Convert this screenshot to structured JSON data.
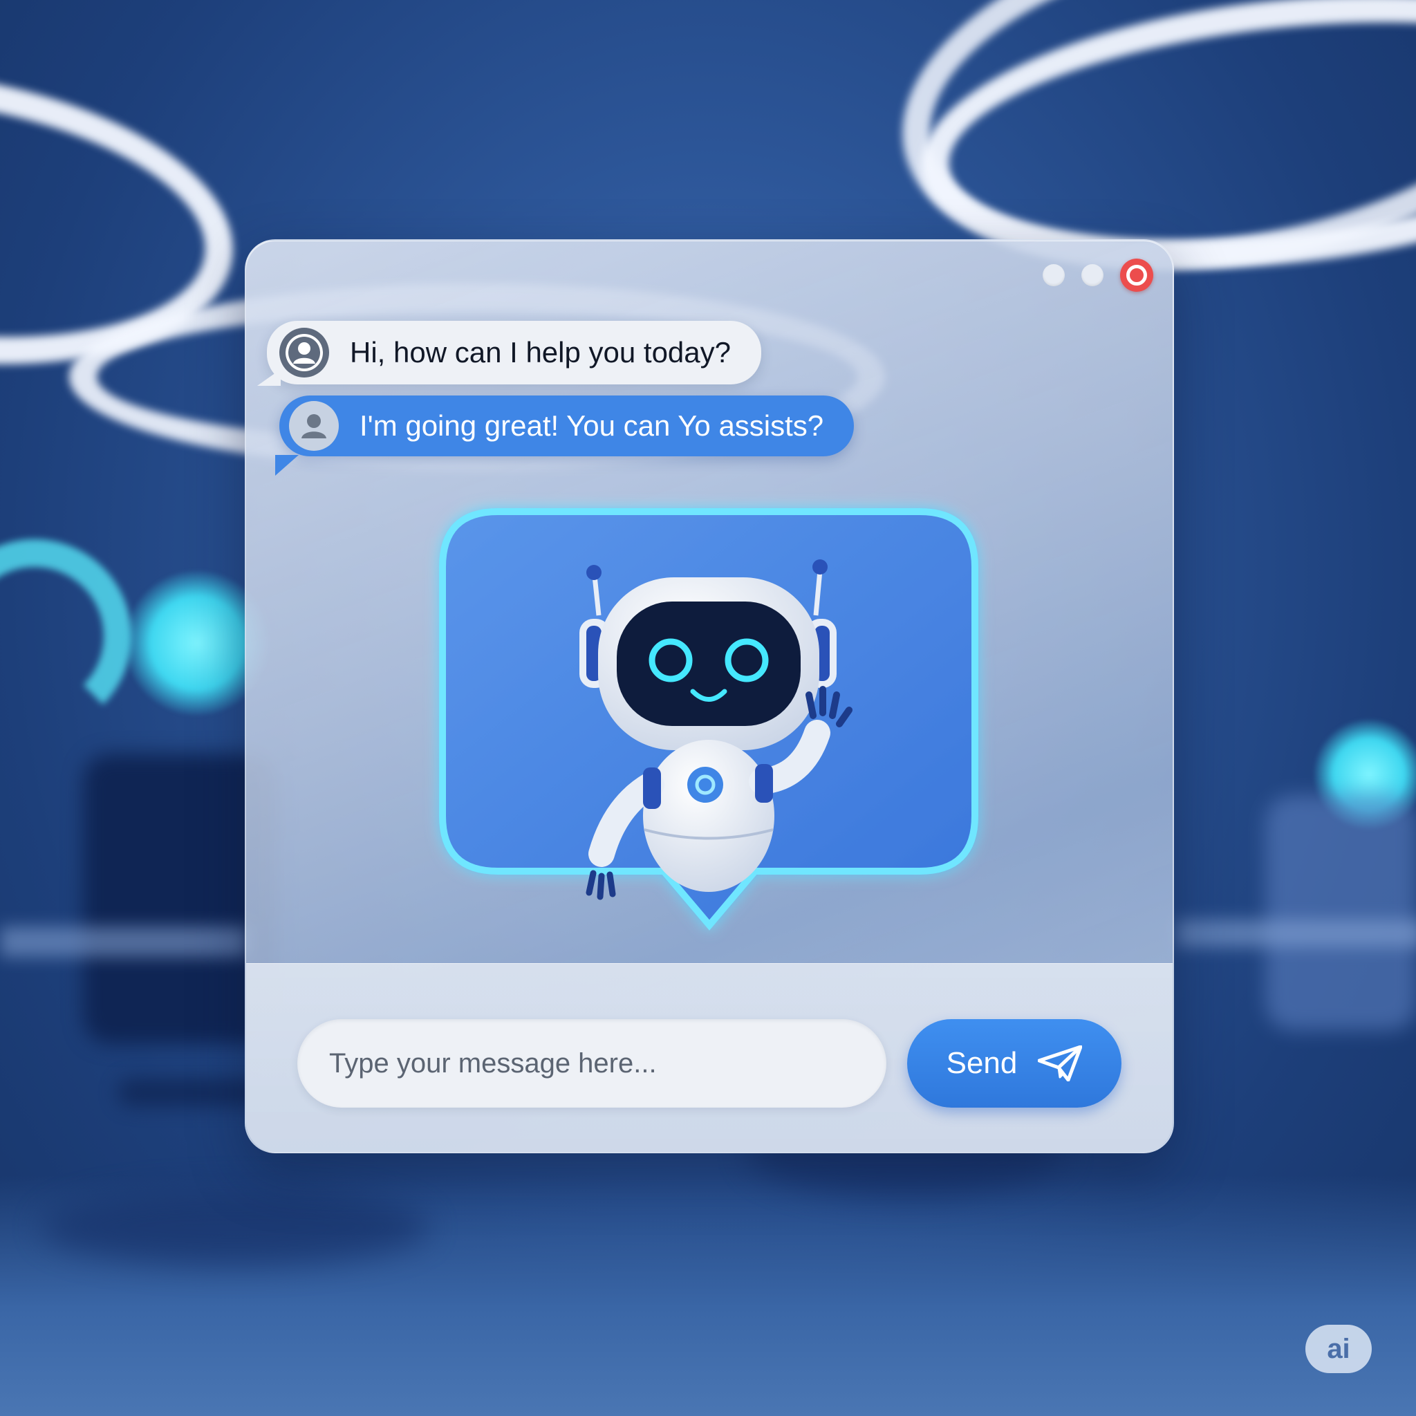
{
  "window": {
    "controls": [
      "minimize",
      "maximize",
      "close"
    ]
  },
  "messages": [
    {
      "sender": "assistant",
      "text": "Hi, how can I help you today?",
      "avatar_icon": "user-avatar-icon"
    },
    {
      "sender": "user",
      "text": "I'm going great! You can Yo assists?",
      "avatar_icon": "user-avatar-icon"
    }
  ],
  "hero": {
    "icon": "waving-robot-icon",
    "glow_color": "#6fe6ff",
    "fill_color": "#4a86e4"
  },
  "composer": {
    "placeholder": "Type your message here...",
    "value": "",
    "send_label": "Send",
    "send_icon": "paper-plane-icon"
  },
  "badge": {
    "label": "ai"
  },
  "colors": {
    "accent": "#3f86e6",
    "close": "#ec4d4d",
    "glow": "#5ee3ff"
  }
}
